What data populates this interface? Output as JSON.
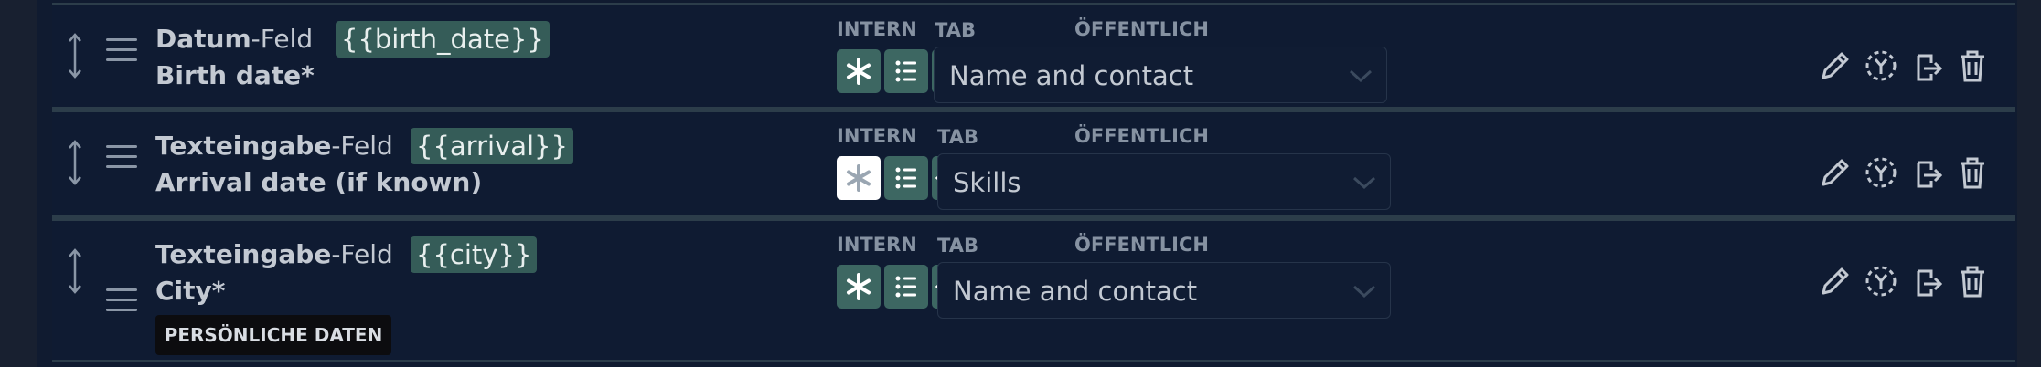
{
  "rows": [
    {
      "type_bold": "Datum",
      "type_suffix": "-Feld",
      "variable": "{{birth_date}}",
      "label": "Birth date*",
      "intern_label": "INTERN",
      "public_label": "ÖFFENTLICH",
      "tab_label": "TAB",
      "tab_value": "Name and contact"
    },
    {
      "type_bold": "Texteingabe",
      "type_suffix": "-Feld",
      "variable": "{{arrival}}",
      "label": "Arrival date (if known)",
      "intern_label": "INTERN",
      "public_label": "ÖFFENTLICH",
      "tab_label": "TAB",
      "tab_value": "Skills"
    },
    {
      "type_bold": "Texteingabe",
      "type_suffix": "-Feld",
      "variable": "{{city}}",
      "label": "City*",
      "tag": "PERSÖNLICHE DATEN",
      "intern_label": "INTERN",
      "public_label": "ÖFFENTLICH",
      "tab_label": "TAB",
      "tab_value": "Name and contact"
    }
  ],
  "colors": {
    "toggle_on": "#3d6762",
    "toggle_off": "#ffffff",
    "background": "#0f1b32"
  },
  "icons": [
    "required-icon",
    "list-icon",
    "visible-icon",
    "editable-icon",
    "play-icon",
    "public-required-icon",
    "document-add-icon",
    "public-editable-icon",
    "pencil-off-icon",
    "pencil-counter-icon"
  ],
  "actions": [
    "edit-icon",
    "variable-icon",
    "copy-icon",
    "delete-icon"
  ]
}
